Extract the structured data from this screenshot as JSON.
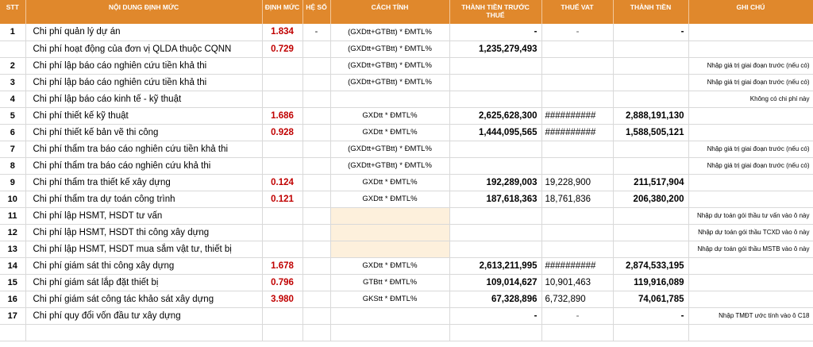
{
  "header": {
    "stt": "STT",
    "noi_dung": "NỘI DUNG ĐỊNH MỨC",
    "dinh_muc": "ĐỊNH MỨC",
    "he_so": "HỆ SỐ",
    "cach_tinh": "CÁCH TÍNH",
    "thanh_tien_truoc_thue": "THÀNH TIỀN TRƯỚC THUẾ",
    "thue_vat": "THUẾ VAT",
    "thanh_tien": "THÀNH TIỀN",
    "ghi_chu": "GHI CHÚ"
  },
  "rows": [
    {
      "stt": "1",
      "name": "Chi phí quản lý dự án",
      "dm": "1.834",
      "hs": "-",
      "ct": "(GXDtt+GTBtt) * ĐMTL%",
      "pre": "-",
      "vat": "-",
      "total": "-",
      "note": ""
    },
    {
      "stt": "",
      "name": "Chi phí hoạt động của đơn vị QLDA thuộc CQNN",
      "dm": "0.729",
      "hs": "",
      "ct": "(GXDtt+GTBtt) * ĐMTL%",
      "pre": "1,235,279,493",
      "vat": "",
      "total": "",
      "note": ""
    },
    {
      "stt": "2",
      "name": "Chi phí lập báo cáo nghiên cứu tiền khả thi",
      "dm": "",
      "hs": "",
      "ct": "(GXDtt+GTBtt) * ĐMTL%",
      "pre": "",
      "vat": "",
      "total": "",
      "note": "Nhập giá trị giai đoạn trước (nếu có)"
    },
    {
      "stt": "3",
      "name": "Chi phí lập báo cáo nghiên cứu tiền khả thi",
      "dm": "",
      "hs": "",
      "ct": "(GXDtt+GTBtt) * ĐMTL%",
      "pre": "",
      "vat": "",
      "total": "",
      "note": "Nhập giá trị giai đoạn trước (nếu có)"
    },
    {
      "stt": "4",
      "name": "Chi phí lập báo cáo kinh tế - kỹ thuật",
      "dm": "",
      "hs": "",
      "ct": "",
      "pre": "",
      "vat": "",
      "total": "",
      "note": "Không có chi phí này"
    },
    {
      "stt": "5",
      "name": "Chi phí thiết kế kỹ thuật",
      "dm": "1.686",
      "hs": "",
      "ct": "GXDtt * ĐMTL%",
      "pre": "2,625,628,300",
      "vat": "##########",
      "total": "2,888,191,130",
      "note": ""
    },
    {
      "stt": "6",
      "name": "Chi phí thiết kế bản vẽ thi công",
      "dm": "0.928",
      "hs": "",
      "ct": "GXDtt * ĐMTL%",
      "pre": "1,444,095,565",
      "vat": "##########",
      "total": "1,588,505,121",
      "note": ""
    },
    {
      "stt": "7",
      "name": "Chi phí thẩm tra báo cáo nghiên cứu tiền khả thi",
      "dm": "",
      "hs": "",
      "ct": "(GXDtt+GTBtt) * ĐMTL%",
      "pre": "",
      "vat": "",
      "total": "",
      "note": "Nhập giá trị giai đoạn trước (nếu có)"
    },
    {
      "stt": "8",
      "name": "Chi phí thẩm tra báo cáo nghiên cứu khả thi",
      "dm": "",
      "hs": "",
      "ct": "(GXDtt+GTBtt) * ĐMTL%",
      "pre": "",
      "vat": "",
      "total": "",
      "note": "Nhập giá trị giai đoạn trước (nếu có)"
    },
    {
      "stt": "9",
      "name": "Chi phí thẩm tra thiết kế xây dựng",
      "dm": "0.124",
      "hs": "",
      "ct": "GXDtt * ĐMTL%",
      "pre": "192,289,003",
      "vat": "19,228,900",
      "total": "211,517,904",
      "note": ""
    },
    {
      "stt": "10",
      "name": "Chi phí thẩm tra dự toán công trình",
      "dm": "0.121",
      "hs": "",
      "ct": "GXDtt * ĐMTL%",
      "pre": "187,618,363",
      "vat": "18,761,836",
      "total": "206,380,200",
      "note": ""
    },
    {
      "stt": "11",
      "name": "Chi phí lập HSMT, HSDT tư vấn",
      "dm": "",
      "hs": "",
      "ct": "",
      "pre": "",
      "vat": "",
      "total": "",
      "note": "Nhập dự toán gói thầu tư vấn vào ô này",
      "yellow": true
    },
    {
      "stt": "12",
      "name": "Chi phí lập HSMT, HSDT thi công xây dựng",
      "dm": "",
      "hs": "",
      "ct": "",
      "pre": "",
      "vat": "",
      "total": "",
      "note": "Nhập dự toán gói thầu TCXD vào ô này",
      "yellow": true
    },
    {
      "stt": "13",
      "name": "Chi phí lập HSMT, HSDT mua sắm vật tư, thiết bị",
      "dm": "",
      "hs": "",
      "ct": "",
      "pre": "",
      "vat": "",
      "total": "",
      "note": "Nhập dự toán gói thầu MSTB vào ô này",
      "yellow": true
    },
    {
      "stt": "14",
      "name": "Chi phí giám sát thi công xây dựng",
      "dm": "1.678",
      "hs": "",
      "ct": "GXDtt * ĐMTL%",
      "pre": "2,613,211,995",
      "vat": "##########",
      "total": "2,874,533,195",
      "note": ""
    },
    {
      "stt": "15",
      "name": "Chi phí giám sát lắp đặt thiết bị",
      "dm": "0.796",
      "hs": "",
      "ct": "GTBtt * ĐMTL%",
      "pre": "109,014,627",
      "vat": "10,901,463",
      "total": "119,916,089",
      "note": ""
    },
    {
      "stt": "16",
      "name": "Chi phí giám sát công tác khảo sát xây dựng",
      "dm": "3.980",
      "hs": "",
      "ct": "GKStt * ĐMTL%",
      "pre": "67,328,896",
      "vat": "6,732,890",
      "total": "74,061,785",
      "note": ""
    },
    {
      "stt": "17",
      "name": "Chi phí quy đổi vốn đầu tư xây dựng",
      "dm": "",
      "hs": "",
      "ct": "",
      "pre": "-",
      "vat": "-",
      "total": "-",
      "note": "Nhập TMĐT ước tính vào ô C18"
    }
  ]
}
